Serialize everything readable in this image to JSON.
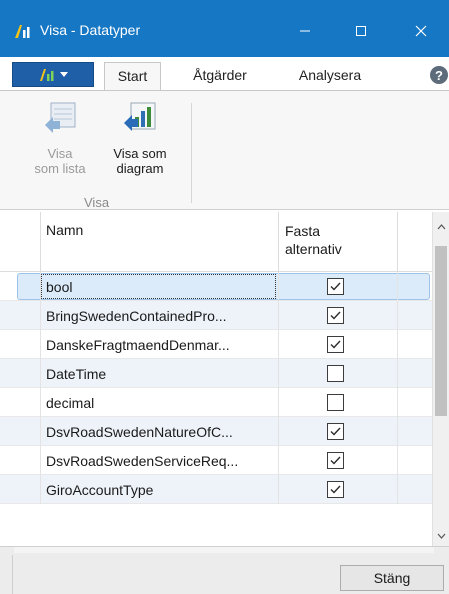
{
  "window": {
    "title": "Visa - Datatyper"
  },
  "ribbon": {
    "tabs": [
      {
        "label": "Start"
      },
      {
        "label": "Åtgärder"
      },
      {
        "label": "Analysera"
      }
    ],
    "buttons": {
      "list_view": {
        "line1": "Visa",
        "line2": "som lista"
      },
      "chart_view": {
        "line1": "Visa som",
        "line2": "diagram"
      }
    },
    "group_label": "Visa"
  },
  "grid": {
    "columns": {
      "name": "Namn",
      "fixed_line1": "Fasta",
      "fixed_line2": "alternativ"
    },
    "rows": [
      {
        "name": "bool",
        "checked": true
      },
      {
        "name": "BringSwedenContainedPro...",
        "checked": true
      },
      {
        "name": "DanskeFragtmaendDenmar...",
        "checked": true
      },
      {
        "name": "DateTime",
        "checked": false
      },
      {
        "name": "decimal",
        "checked": false
      },
      {
        "name": "DsvRoadSwedenNatureOfC...",
        "checked": true
      },
      {
        "name": "DsvRoadSwedenServiceReq...",
        "checked": true
      },
      {
        "name": "GiroAccountType",
        "checked": true
      }
    ]
  },
  "footer": {
    "close_label": "Stäng"
  },
  "colors": {
    "titlebar": "#1677c4",
    "selection": "#dcebfa",
    "alt_row": "#eef3fa"
  }
}
